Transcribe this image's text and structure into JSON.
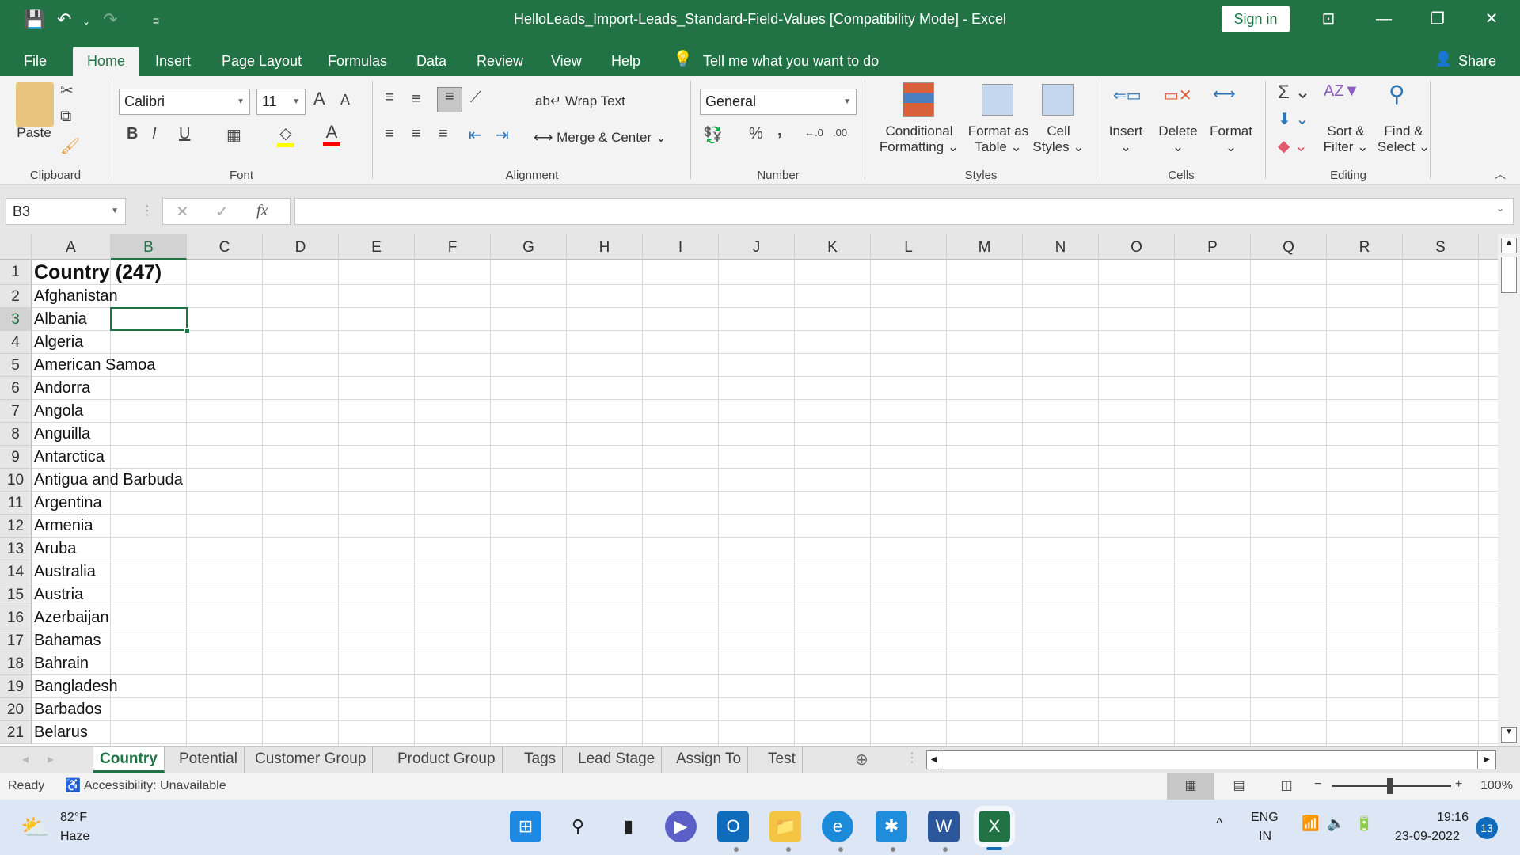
{
  "title_bar": {
    "title": "HelloLeads_Import-Leads_Standard-Field-Values  [Compatibility Mode]  -  Excel",
    "sign_in": "Sign in",
    "share": "Share"
  },
  "menu_tabs": [
    "File",
    "Home",
    "Insert",
    "Page Layout",
    "Formulas",
    "Data",
    "Review",
    "View",
    "Help"
  ],
  "tell_me": "Tell me what you want to do",
  "ribbon": {
    "clipboard": {
      "label": "Clipboard",
      "paste": "Paste"
    },
    "font": {
      "label": "Font",
      "font_name": "Calibri",
      "font_size": "11",
      "bold": "B",
      "italic": "I",
      "underline": "U",
      "font_color": "#ff0000",
      "fill_color": "#ffff00"
    },
    "alignment": {
      "label": "Alignment",
      "wrap_text": "Wrap Text",
      "merge_center": "Merge & Center"
    },
    "number": {
      "label": "Number",
      "format": "General",
      "percent": "%",
      "comma": ","
    },
    "styles": {
      "label": "Styles",
      "conditional": "Conditional",
      "conditional2": "Formatting",
      "format_as": "Format as",
      "format_as2": "Table",
      "cell": "Cell",
      "cell2": "Styles"
    },
    "cells": {
      "label": "Cells",
      "insert": "Insert",
      "delete": "Delete",
      "format": "Format"
    },
    "editing": {
      "label": "Editing",
      "sort": "Sort &",
      "sort2": "Filter",
      "find": "Find &",
      "find2": "Select"
    }
  },
  "formula_bar": {
    "name_box": "B3",
    "fx": "fx",
    "formula": ""
  },
  "columns": [
    "A",
    "B",
    "C",
    "D",
    "E",
    "F",
    "G",
    "H",
    "I",
    "J",
    "K",
    "L",
    "M",
    "N",
    "O",
    "P",
    "Q",
    "R",
    "S"
  ],
  "selected_cell": {
    "col": "B",
    "row": 3
  },
  "rows": [
    {
      "n": "1",
      "a": "Country (247)",
      "bold": true
    },
    {
      "n": "2",
      "a": "Afghanistan"
    },
    {
      "n": "3",
      "a": "Albania"
    },
    {
      "n": "4",
      "a": "Algeria"
    },
    {
      "n": "5",
      "a": "American Samoa"
    },
    {
      "n": "6",
      "a": "Andorra"
    },
    {
      "n": "7",
      "a": "Angola"
    },
    {
      "n": "8",
      "a": "Anguilla"
    },
    {
      "n": "9",
      "a": "Antarctica"
    },
    {
      "n": "10",
      "a": "Antigua and Barbuda"
    },
    {
      "n": "11",
      "a": "Argentina"
    },
    {
      "n": "12",
      "a": "Armenia"
    },
    {
      "n": "13",
      "a": "Aruba"
    },
    {
      "n": "14",
      "a": "Australia"
    },
    {
      "n": "15",
      "a": "Austria"
    },
    {
      "n": "16",
      "a": "Azerbaijan"
    },
    {
      "n": "17",
      "a": "Bahamas"
    },
    {
      "n": "18",
      "a": "Bahrain"
    },
    {
      "n": "19",
      "a": "Bangladesh"
    },
    {
      "n": "20",
      "a": "Barbados"
    },
    {
      "n": "21",
      "a": "Belarus"
    }
  ],
  "sheet_tabs": [
    "Country",
    "Potential",
    "Customer Group",
    "Product Group",
    "Tags",
    "Lead Stage",
    "Assign To",
    "Test"
  ],
  "active_sheet": "Country",
  "status_bar": {
    "ready": "Ready",
    "accessibility": "Accessibility: Unavailable",
    "zoom": "100%",
    "zoom_minus": "−",
    "zoom_plus": "+"
  },
  "taskbar": {
    "temp": "82°F",
    "weather": "Haze",
    "lang1": "ENG",
    "lang2": "IN",
    "time": "19:16",
    "date": "23-09-2022",
    "notifications": "13"
  },
  "colors": {
    "accent": "#217346"
  }
}
